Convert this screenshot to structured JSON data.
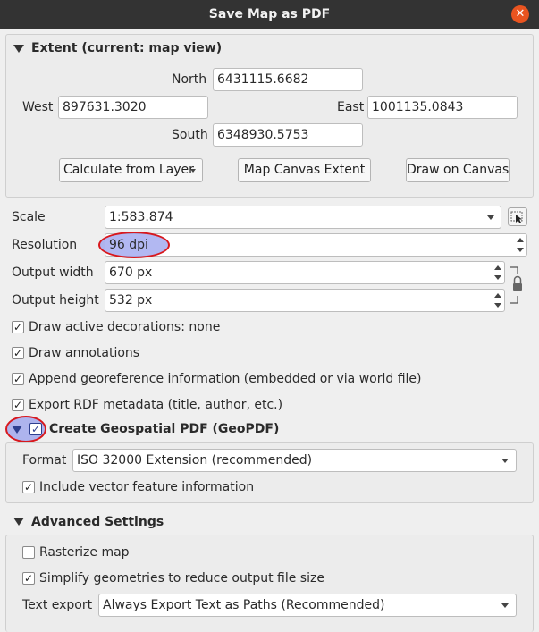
{
  "window": {
    "title": "Save Map as PDF",
    "close_glyph": "✕"
  },
  "extent": {
    "header": "Extent (current: map view)",
    "north_label": "North",
    "north_value": "6431115.6682",
    "west_label": "West",
    "west_value": "897631.3020",
    "east_label": "East",
    "east_value": "1001135.0843",
    "south_label": "South",
    "south_value": "6348930.5753",
    "calc_from_layer": "Calculate from Layer",
    "map_canvas_extent": "Map Canvas Extent",
    "draw_on_canvas": "Draw on Canvas"
  },
  "settings": {
    "scale_label": "Scale",
    "scale_value": "1:583.874",
    "resolution_label": "Resolution",
    "resolution_value": "96 dpi",
    "width_label": "Output width",
    "width_value": "670 px",
    "height_label": "Output height",
    "height_value": "532 px"
  },
  "options": {
    "draw_decorations": "Draw active decorations: none",
    "draw_annotations": "Draw annotations",
    "append_georef": "Append georeference information (embedded or via world file)",
    "export_rdf": "Export RDF metadata (title, author, etc.)"
  },
  "geopdf": {
    "header": "Create Geospatial PDF (GeoPDF)",
    "format_label": "Format",
    "format_value": "ISO 32000 Extension (recommended)",
    "include_vector": "Include vector feature information"
  },
  "advanced": {
    "header": "Advanced Settings",
    "rasterize": "Rasterize map",
    "simplify": "Simplify geometries to reduce output file size",
    "text_export_label": "Text export",
    "text_export_value": "Always Export Text as Paths (Recommended)"
  },
  "checkmark": "✓",
  "colors": {
    "titlebar": "#333333",
    "close": "#e95420",
    "highlight_ring": "#d8181d",
    "highlight_fill": "#98a0ee"
  },
  "icons": [
    "close-icon",
    "collapse-arrow-icon",
    "dropdown-arrow-icon",
    "spin-arrows-icon",
    "pointer-select-icon",
    "lock-icon"
  ]
}
